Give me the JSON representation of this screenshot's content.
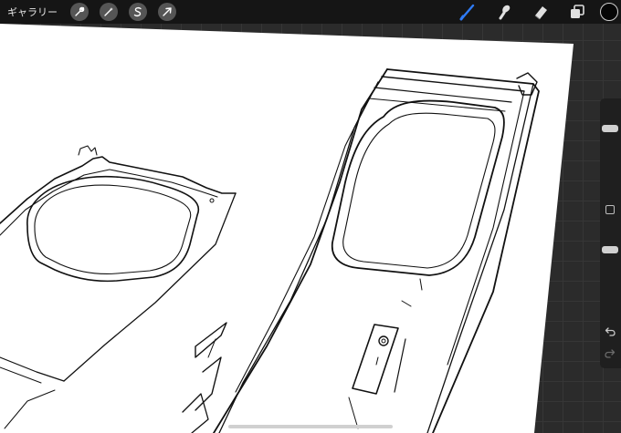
{
  "topbar": {
    "gallery_label": "ギャラリー",
    "left_tools": [
      {
        "name": "actions",
        "icon": "wrench-icon"
      },
      {
        "name": "adjustments",
        "icon": "magic-wand-icon"
      },
      {
        "name": "selection",
        "icon": "selection-s-icon"
      },
      {
        "name": "transform",
        "icon": "arrow-cursor-icon"
      }
    ],
    "right_tools": [
      {
        "name": "brush",
        "icon": "brush-icon",
        "active": true
      },
      {
        "name": "smudge",
        "icon": "smudge-icon",
        "active": false
      },
      {
        "name": "eraser",
        "icon": "eraser-icon",
        "active": false
      },
      {
        "name": "layers",
        "icon": "layers-icon",
        "active": false
      }
    ],
    "current_color": "#050505",
    "active_tool_color": "#2f7bf6"
  },
  "sidebar": {
    "brush_size_level": 0.28,
    "opacity_level": 0.3
  }
}
